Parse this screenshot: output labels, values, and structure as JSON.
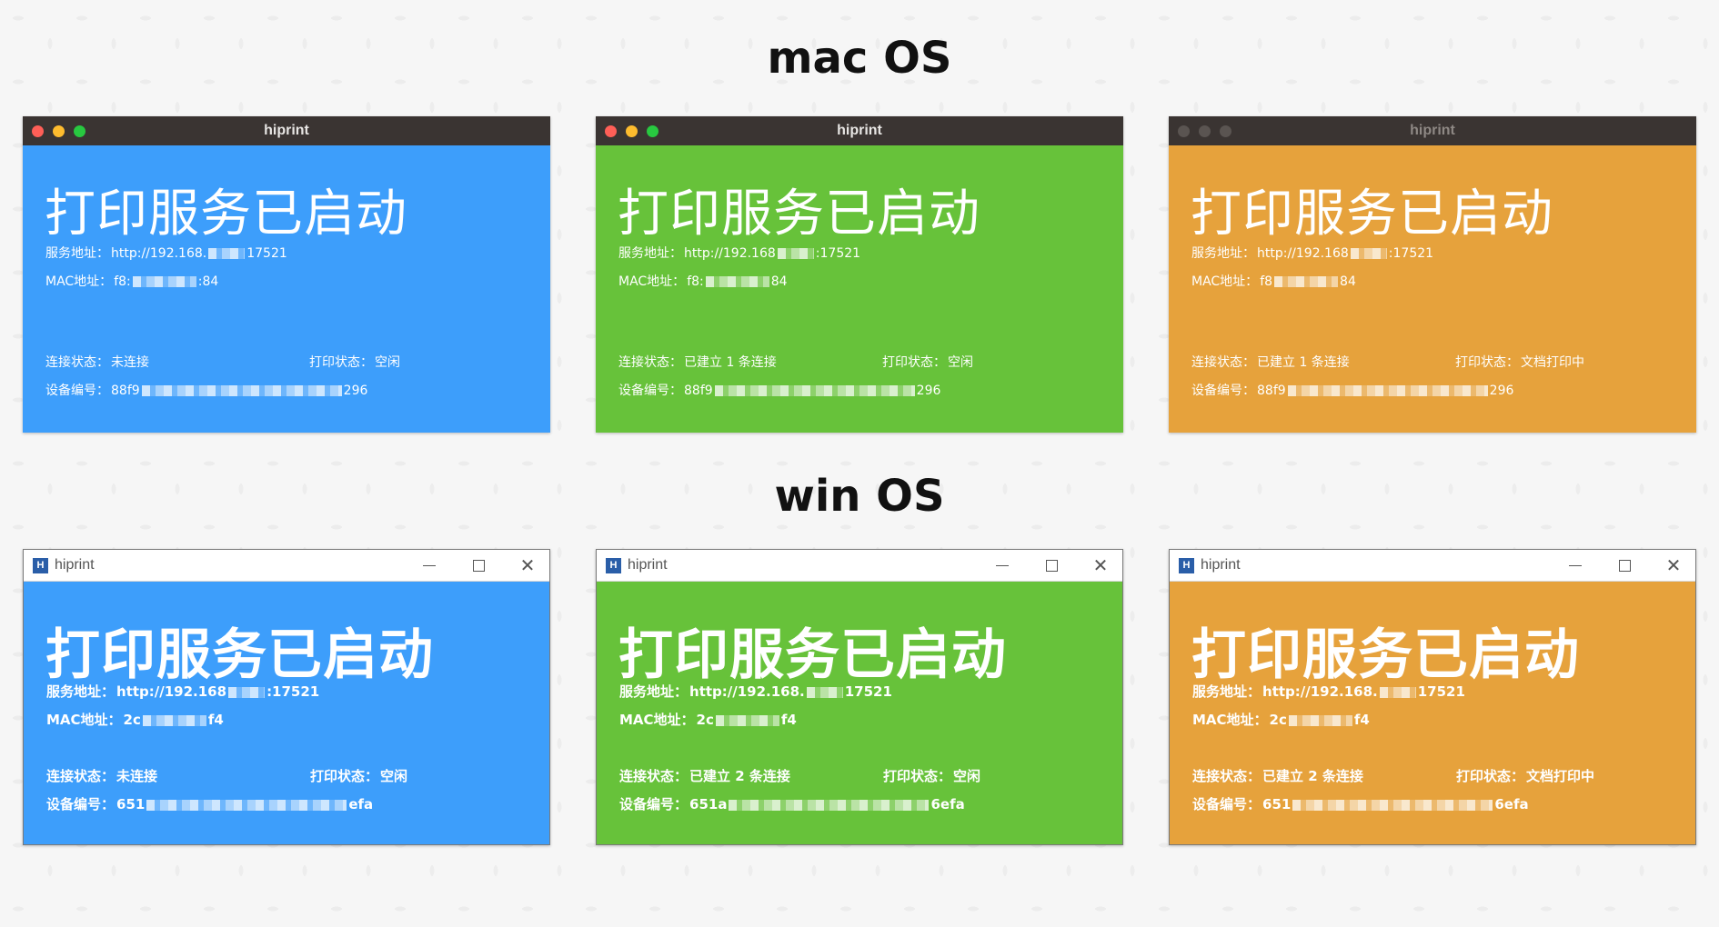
{
  "sections": {
    "mac_title": "mac OS",
    "win_title": "win OS"
  },
  "app_title": "hiprint",
  "app_icon_letter": "H",
  "labels": {
    "headline": "打印服务已启动",
    "address": "服务地址：",
    "mac": "MAC地址：",
    "connection": "连接状态：",
    "print": "打印状态：",
    "device": "设备编号："
  },
  "mac_windows": [
    {
      "theme": "blue",
      "active": true,
      "address_start": "http://192.168.",
      "address_end": "17521",
      "mac_start": "f8:",
      "mac_end": ":84",
      "connection": "未连接",
      "print": "空闲",
      "device_start": "88f9",
      "device_end": "296"
    },
    {
      "theme": "green",
      "active": true,
      "address_start": "http://192.168",
      "address_end": ":17521",
      "mac_start": "f8:",
      "mac_end": "84",
      "connection": "已建立 1 条连接",
      "print": "空闲",
      "device_start": "88f9",
      "device_end": "296"
    },
    {
      "theme": "orange",
      "active": false,
      "address_start": "http://192.168",
      "address_end": ":17521",
      "mac_start": "f8",
      "mac_end": "84",
      "connection": "已建立 1 条连接",
      "print": "文档打印中",
      "device_start": "88f9",
      "device_end": "296"
    }
  ],
  "win_windows": [
    {
      "theme": "blue",
      "address_start": "http://192.168",
      "address_end": ":17521",
      "mac_start": "2c",
      "mac_end": "f4",
      "connection": "未连接",
      "print": "空闲",
      "device_start": "651",
      "device_end": "efa"
    },
    {
      "theme": "green",
      "address_start": "http://192.168.",
      "address_end": "17521",
      "mac_start": "2c",
      "mac_end": "f4",
      "connection": "已建立 2 条连接",
      "print": "空闲",
      "device_start": "651a",
      "device_end": "6efa"
    },
    {
      "theme": "orange",
      "address_start": "http://192.168.",
      "address_end": "17521",
      "mac_start": "2c",
      "mac_end": "f4",
      "connection": "已建立 2 条连接",
      "print": "文档打印中",
      "device_start": "651",
      "device_end": "6efa"
    }
  ],
  "colors": {
    "blue": "#3d9efb",
    "green": "#67c23a",
    "orange": "#e6a23c",
    "mac_titlebar": "#3a3432"
  },
  "icons": [
    "window-close-icon",
    "window-minimize-icon",
    "window-maximize-icon",
    "hiprint-app-icon"
  ]
}
